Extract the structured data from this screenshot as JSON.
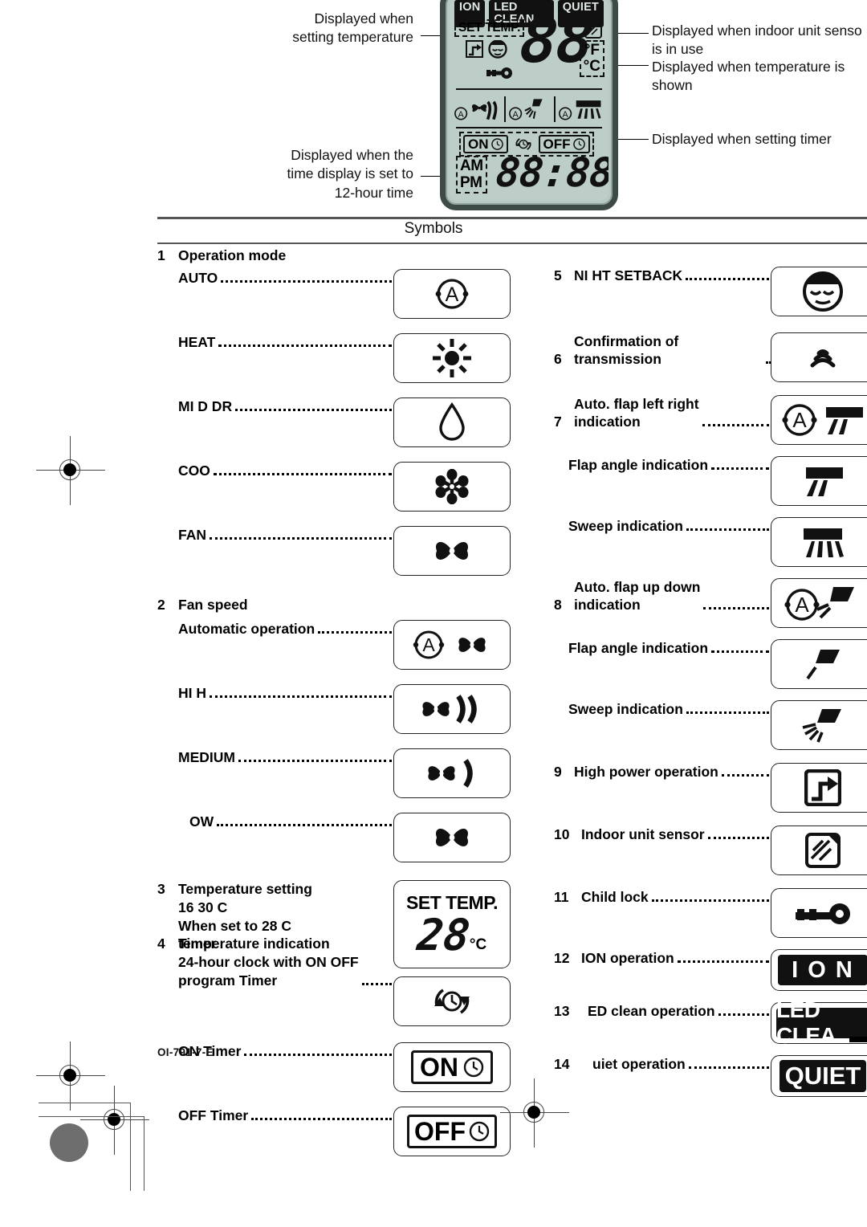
{
  "annotations": {
    "left": [
      {
        "id": "set-temp-note",
        "text": "Displayed when\nsetting temperature"
      },
      {
        "id": "ampm-note",
        "text": "Displayed when the\ntime display is set to\n12-hour time"
      }
    ],
    "right": [
      {
        "id": "sensor-note",
        "text": "Displayed when indoor unit senso\nis in use"
      },
      {
        "id": "temp-shown-note",
        "text": "Displayed when temperature is\nshown"
      },
      {
        "id": "timer-note",
        "text": "Displayed when setting timer"
      }
    ]
  },
  "lcd": {
    "badges": [
      "ION",
      "LED CLEAN",
      "QUIET"
    ],
    "set_temp_tag": "SET TEMP.",
    "big_temp": "88",
    "unit_f": "°F",
    "unit_c": "°C",
    "timer_on": "ON",
    "timer_off": "OFF",
    "am": "AM",
    "pm": "PM",
    "clock": "88:88"
  },
  "symbols_title": "Symbols",
  "left_column": [
    {
      "type": "section",
      "number": "1",
      "title": "Operation mode",
      "rows": [
        {
          "label": "AUTO",
          "icon": "auto-mode-icon",
          "box": "lw"
        },
        {
          "label": "HEAT",
          "icon": "sun-heat-icon",
          "box": "lw"
        },
        {
          "label": "MI  D DR",
          "icon": "water-drop-icon",
          "box": "lw"
        },
        {
          "label": "COO",
          "icon": "snowflake-icon",
          "box": "lw"
        },
        {
          "label": "FAN",
          "icon": "fan-icon",
          "box": "lw"
        }
      ]
    },
    {
      "type": "section",
      "number": "2",
      "title": "Fan speed",
      "rows": [
        {
          "label": "Automatic operation",
          "icon": "auto-fan-icon",
          "box": "lw"
        },
        {
          "label": "HI  H",
          "icon": "fan-high-icon",
          "box": "lw"
        },
        {
          "label": "MEDIUM",
          "icon": "fan-medium-icon",
          "box": "lw"
        },
        {
          "label": "OW",
          "icon": "fan-low-icon",
          "box": "lw"
        }
      ]
    },
    {
      "type": "section",
      "number": "3",
      "title": "Temperature setting\n16  30 C\nWhen set to 28 C\ntemperature indication",
      "rows": [],
      "inline_icon": "set-temp-display-icon",
      "inline_box": "tall"
    },
    {
      "type": "section",
      "number": "4",
      "title": "Timer\n24-hour clock with ON OFF\nprogram Timer",
      "inline_icon": "program-timer-icon",
      "inline_box": "lw",
      "rows": [
        {
          "label": "ON Timer",
          "icon": "on-timer-icon",
          "box": "lw"
        },
        {
          "label": "OFF Timer",
          "icon": "off-timer-icon",
          "box": "lw"
        }
      ]
    }
  ],
  "right_column": [
    {
      "number": "5",
      "label": "NI  HT SETBACK",
      "icon": "night-setback-face-icon",
      "box": "r"
    },
    {
      "number": "6",
      "label": "Confirmation of transmission",
      "icon": "transmission-wave-icon",
      "box": "r",
      "dots": "short"
    },
    {
      "number": "7",
      "label": "Auto. flap left right\nindication",
      "icon": "auto-flap-lr-icon",
      "box": "r"
    },
    {
      "number": "",
      "label": "Flap angle indication",
      "icon": "flap-angle-lr-icon",
      "box": "r",
      "indent": true
    },
    {
      "number": "",
      "label": "Sweep indication",
      "icon": "sweep-lr-icon",
      "box": "r",
      "indent": true
    },
    {
      "number": "8",
      "label": "Auto. flap up down\nindication",
      "icon": "auto-flap-ud-icon",
      "box": "r"
    },
    {
      "number": "",
      "label": "Flap angle indication",
      "icon": "flap-angle-ud-icon",
      "box": "r",
      "indent": true
    },
    {
      "number": "",
      "label": "Sweep indication",
      "icon": "sweep-ud-icon",
      "box": "r",
      "indent": true
    },
    {
      "number": "9",
      "label": "High power operation",
      "icon": "high-power-icon",
      "box": "r"
    },
    {
      "number": "10",
      "label": "Indoor unit sensor",
      "icon": "indoor-sensor-icon",
      "box": "r"
    },
    {
      "number": "11",
      "label": "Child lock",
      "icon": "key-lock-icon",
      "box": "r"
    },
    {
      "number": "12",
      "label": "ION operation",
      "icon": "ion-badge-icon",
      "box": "rshort",
      "badge_text": "I O N"
    },
    {
      "number": "13",
      "label": "ED clean operation",
      "icon": "led-clean-badge-icon",
      "box": "rshort",
      "badge_text": "LED CLEA"
    },
    {
      "number": "14",
      "label": "uiet operation",
      "icon": "quiet-badge-icon",
      "box": "rshort",
      "badge_text": "QUIET"
    }
  ],
  "footer": {
    "doc_code": "OI-791-7-E"
  }
}
